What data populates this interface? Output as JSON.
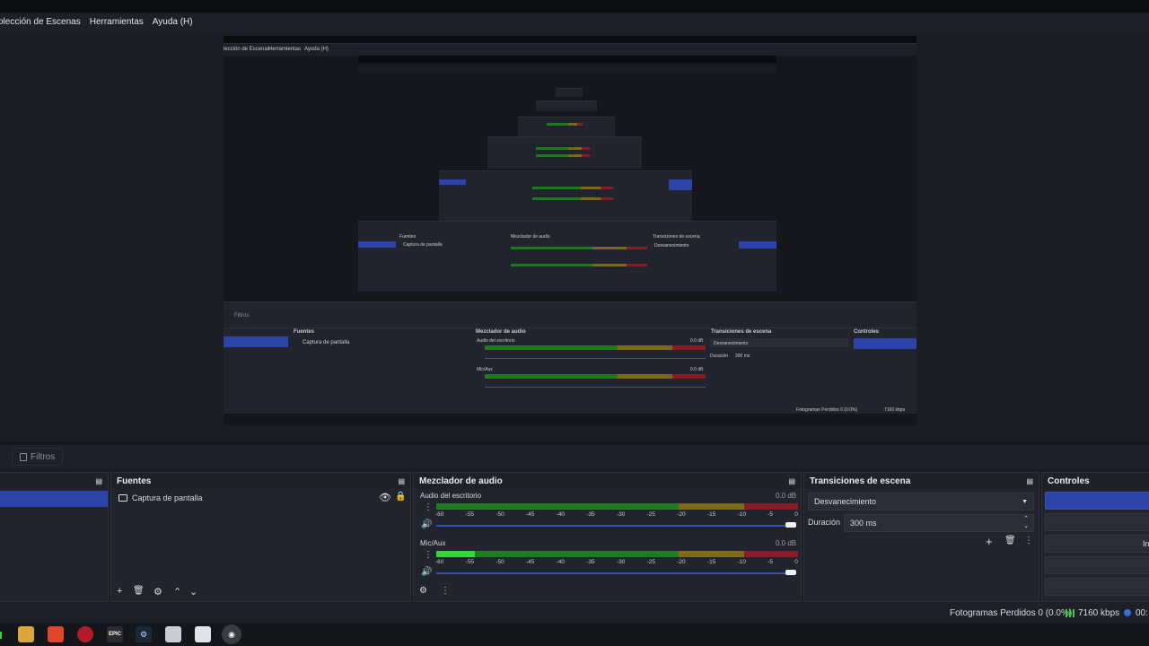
{
  "menu": [
    "olección de Escenas",
    "Herramientas",
    "Ayuda (H)"
  ],
  "preview": {
    "menu": [
      "lección de Escenas",
      "Herramientas",
      "Ayuda (H)"
    ],
    "filters_label": "Filtros",
    "sources_title": "Fuentes",
    "source_item": "Captura de pantalla",
    "mixer_title": "Mezclador de audio",
    "desktop_audio": "Audio del escritorio",
    "mic": "Mic/Aux",
    "db": "0.0 dB",
    "transitions_title": "Transiciones de escena",
    "transition_value": "Desvanecimiento",
    "duration_label": "Duración",
    "duration_value": "300 ms",
    "controls_title": "Controles",
    "status": "Fotogramas Perdidos 0 (0.0%)",
    "bitrate": "7160 kbps"
  },
  "filters_label": "Filtros",
  "sources": {
    "title": "Fuentes",
    "items": [
      {
        "label": "Captura de pantalla",
        "icon": "monitor-icon"
      }
    ]
  },
  "mixer": {
    "title": "Mezclador de audio",
    "channels": [
      {
        "name": "Audio del escritorio",
        "db": "0.0 dB",
        "level": 0.0
      },
      {
        "name": "Mic/Aux",
        "db": "0.0 dB",
        "level": 0.16
      }
    ],
    "ticks": [
      "-60",
      "-55",
      "-50",
      "-45",
      "-40",
      "-35",
      "-30",
      "-25",
      "-20",
      "-15",
      "-10",
      "-5",
      "0"
    ]
  },
  "transitions": {
    "title": "Transiciones de escena",
    "selected": "Desvanecimiento",
    "duration_label": "Duración",
    "duration_value": "300 ms"
  },
  "controls": {
    "title": "Controles",
    "partial_label": "In"
  },
  "status": {
    "dropped": "Fotogramas Perdidos 0 (0.0%)",
    "bitrate": "7160 kbps",
    "time": "00:"
  },
  "colors": {
    "accent": "#2c44a8",
    "meter_green": "#1f7d1f",
    "meter_yellow": "#7d6b15",
    "meter_red": "#8a1b2b"
  }
}
